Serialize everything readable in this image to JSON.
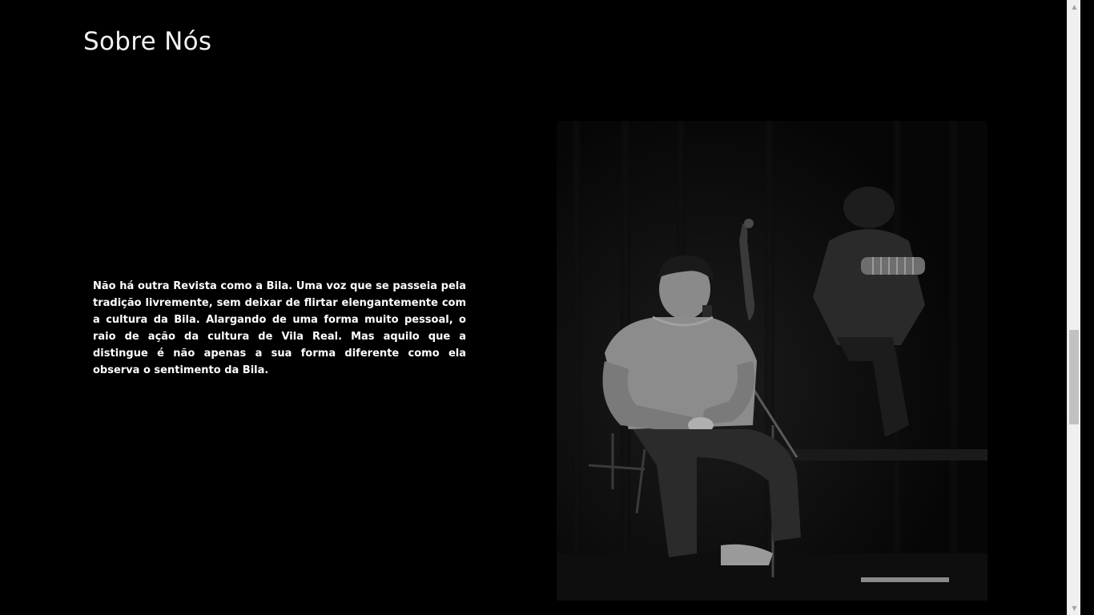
{
  "page": {
    "title": "Sobre Nós",
    "about_text": "Não há outra Revista como a Bila. Uma voz que se passeia pela tradição livremente, sem deixar de flirtar elengantemente com a cultura da Bila. Alargando de uma forma muito pessoal, o raio de ação da cultura de Vila Real. Mas aquilo que a distingue é não apenas a sua forma diferente como ela observa o sentimento da Bila."
  },
  "photo": {
    "subject": "black-and-white concert photo: singer seated at microphone, musician behind"
  },
  "scrollbar": {
    "up_icon": "▲",
    "down_icon": "▼"
  },
  "colors": {
    "background": "#000000",
    "text": "#ffffff",
    "scrollbar_track": "#f0f0f0",
    "scrollbar_thumb": "#c1c1c1"
  }
}
